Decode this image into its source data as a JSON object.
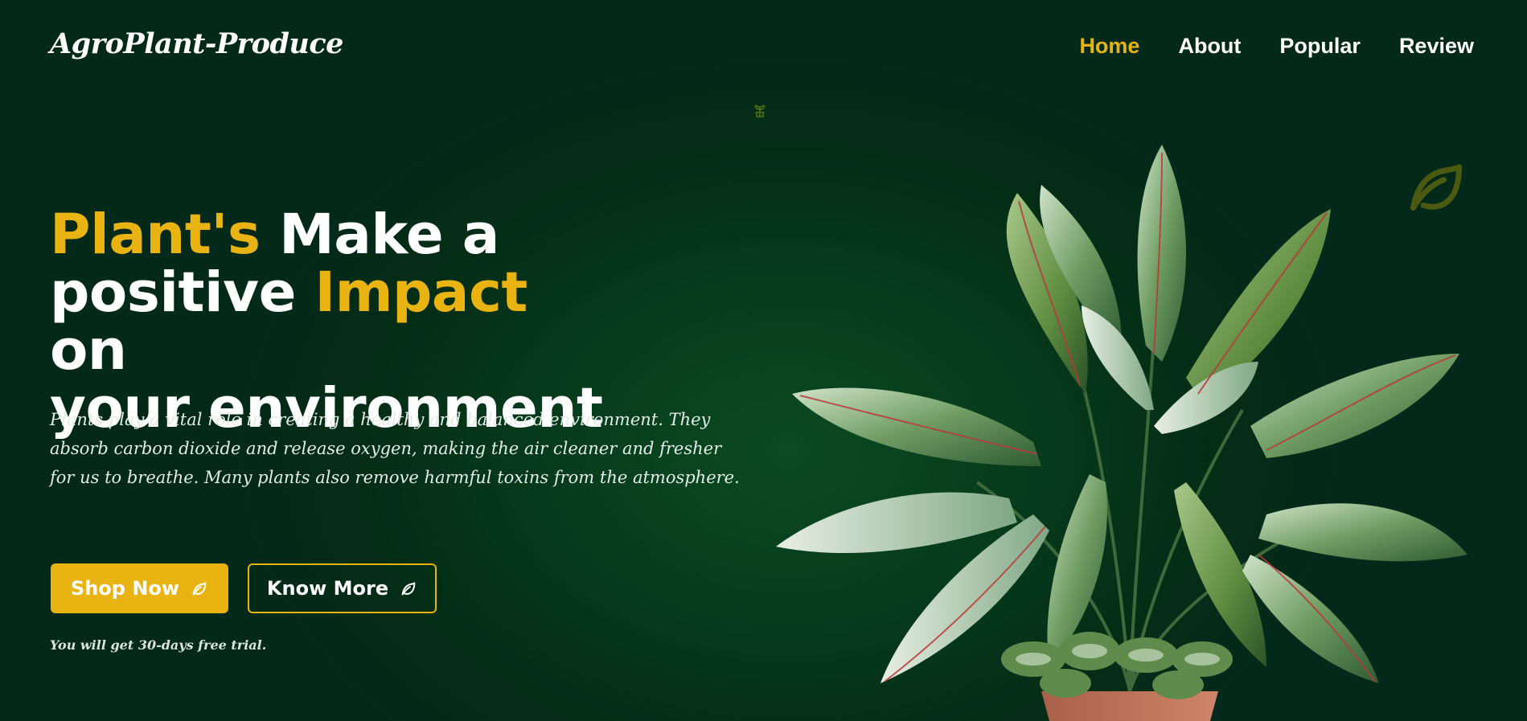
{
  "brand": {
    "name": "AgroPlant-Produce"
  },
  "nav": {
    "items": [
      {
        "label": "Home",
        "active": true
      },
      {
        "label": "About",
        "active": false
      },
      {
        "label": "Popular",
        "active": false
      },
      {
        "label": "Review",
        "active": false
      }
    ]
  },
  "hero": {
    "title_part1": "Plant's",
    "title_part2": " Make a",
    "title_part3": "positive ",
    "title_part4": "Impact",
    "title_part5": " on",
    "title_part6": "your environment",
    "description": "Plants play a vital role in creating a healthy and balanced environment. They absorb carbon dioxide and release oxygen, making the air cleaner and fresher for us to breathe. Many plants also remove harmful toxins from the atmosphere.",
    "shop_button": "Shop Now",
    "know_button": "Know More",
    "trial_note": "You will get 30-days free trial."
  },
  "icons": {
    "button_icon": "leaf-icon",
    "sprout": "sprout-icon",
    "decor_leaf": "leaf-icon"
  },
  "colors": {
    "accent": "#e9b311",
    "background": "#042d16",
    "text": "#ffffff"
  }
}
